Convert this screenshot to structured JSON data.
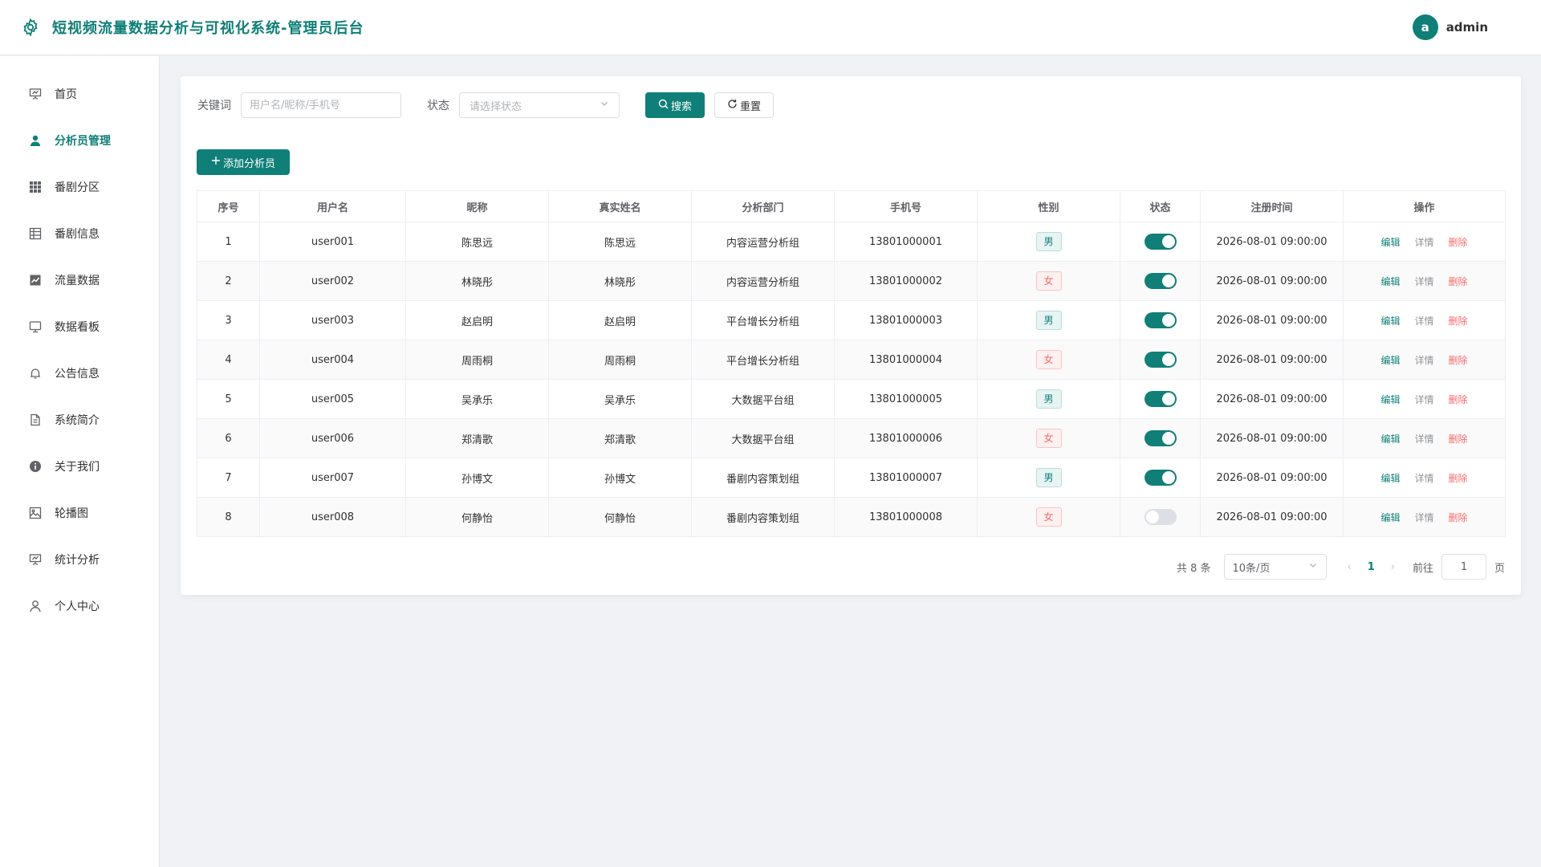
{
  "app": {
    "title": "短视频流量数据分析与可视化系统-管理员后台",
    "brand_color": "#0f7f77"
  },
  "user": {
    "avatar_letter": "a",
    "name": "admin"
  },
  "sidebar": {
    "items": [
      {
        "label": "首页",
        "icon": "presentation-icon"
      },
      {
        "label": "分析员管理",
        "icon": "user-icon",
        "active": true
      },
      {
        "label": "番剧分区",
        "icon": "grid-icon"
      },
      {
        "label": "番剧信息",
        "icon": "table-icon"
      },
      {
        "label": "流量数据",
        "icon": "chart-icon"
      },
      {
        "label": "数据看板",
        "icon": "monitor-icon"
      },
      {
        "label": "公告信息",
        "icon": "bell-icon"
      },
      {
        "label": "系统简介",
        "icon": "document-icon"
      },
      {
        "label": "关于我们",
        "icon": "info-icon"
      },
      {
        "label": "轮播图",
        "icon": "picture-icon"
      },
      {
        "label": "统计分析",
        "icon": "presentation-icon"
      },
      {
        "label": "个人中心",
        "icon": "user-outline-icon"
      }
    ]
  },
  "search": {
    "keyword_label": "关键词",
    "keyword_placeholder": "用户名/昵称/手机号",
    "status_label": "状态",
    "status_placeholder": "请选择状态",
    "search_button": "搜索",
    "reset_button": "重置"
  },
  "add_button": "添加分析员",
  "table": {
    "headers": [
      "序号",
      "用户名",
      "昵称",
      "真实姓名",
      "分析部门",
      "手机号",
      "性别",
      "状态",
      "注册时间",
      "操作"
    ],
    "actions": {
      "edit": "编辑",
      "detail": "详情",
      "delete": "删除"
    },
    "rows": [
      {
        "index": "1",
        "username": "user001",
        "nickname": "陈思远",
        "realname": "陈思远",
        "dept": "内容运营分析组",
        "phone": "13801000001",
        "gender": "男",
        "enabled": true,
        "time": "2026-08-01 09:00:00"
      },
      {
        "index": "2",
        "username": "user002",
        "nickname": "林晓彤",
        "realname": "林晓彤",
        "dept": "内容运营分析组",
        "phone": "13801000002",
        "gender": "女",
        "enabled": true,
        "time": "2026-08-01 09:00:00"
      },
      {
        "index": "3",
        "username": "user003",
        "nickname": "赵启明",
        "realname": "赵启明",
        "dept": "平台增长分析组",
        "phone": "13801000003",
        "gender": "男",
        "enabled": true,
        "time": "2026-08-01 09:00:00"
      },
      {
        "index": "4",
        "username": "user004",
        "nickname": "周雨桐",
        "realname": "周雨桐",
        "dept": "平台增长分析组",
        "phone": "13801000004",
        "gender": "女",
        "enabled": true,
        "time": "2026-08-01 09:00:00"
      },
      {
        "index": "5",
        "username": "user005",
        "nickname": "吴承乐",
        "realname": "吴承乐",
        "dept": "大数据平台组",
        "phone": "13801000005",
        "gender": "男",
        "enabled": true,
        "time": "2026-08-01 09:00:00"
      },
      {
        "index": "6",
        "username": "user006",
        "nickname": "郑清歌",
        "realname": "郑清歌",
        "dept": "大数据平台组",
        "phone": "13801000006",
        "gender": "女",
        "enabled": true,
        "time": "2026-08-01 09:00:00"
      },
      {
        "index": "7",
        "username": "user007",
        "nickname": "孙博文",
        "realname": "孙博文",
        "dept": "番剧内容策划组",
        "phone": "13801000007",
        "gender": "男",
        "enabled": true,
        "time": "2026-08-01 09:00:00"
      },
      {
        "index": "8",
        "username": "user008",
        "nickname": "何静怡",
        "realname": "何静怡",
        "dept": "番剧内容策划组",
        "phone": "13801000008",
        "gender": "女",
        "enabled": false,
        "time": "2026-08-01 09:00:00"
      }
    ]
  },
  "pagination": {
    "total_text": "共 8 条",
    "page_size": "10条/页",
    "current_page": "1",
    "goto_label": "前往",
    "goto_value": "1",
    "page_suffix": "页"
  }
}
